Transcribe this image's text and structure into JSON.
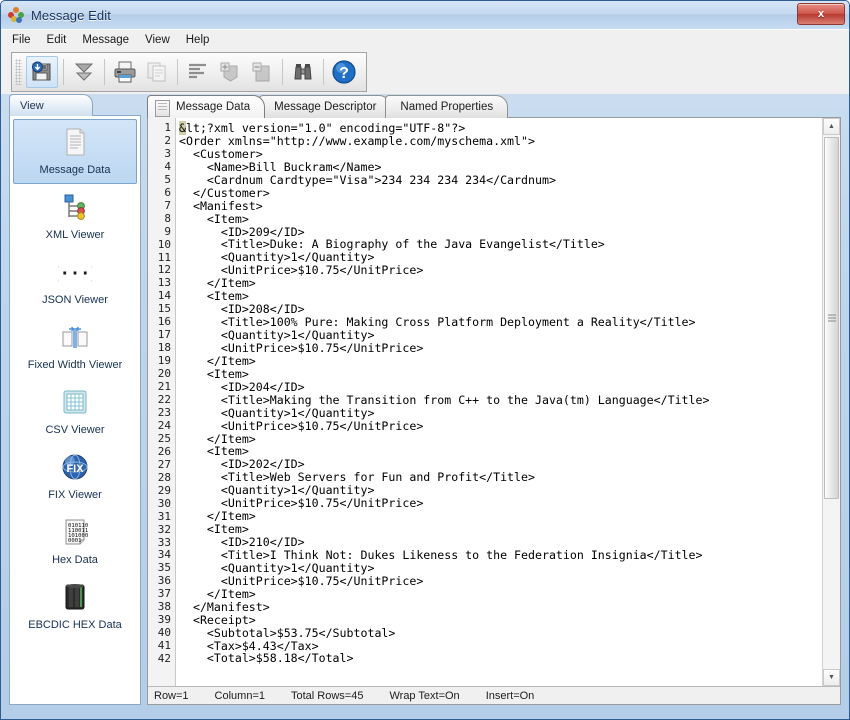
{
  "window": {
    "title": "Message Edit",
    "app_icon": "pinwheel-icon",
    "close_label": "x"
  },
  "menubar": {
    "items": [
      {
        "label": "File"
      },
      {
        "label": "Edit"
      },
      {
        "label": "Message"
      },
      {
        "label": "View"
      },
      {
        "label": "Help"
      }
    ]
  },
  "toolbar": {
    "buttons": [
      {
        "name": "save-button",
        "icon": "save-icon",
        "enabled": true
      },
      {
        "name": "collapse-all-button",
        "icon": "double-down-arrow-icon",
        "enabled": true
      },
      {
        "name": "print-button",
        "icon": "printer-icon",
        "enabled": true
      },
      {
        "name": "copy-button",
        "icon": "copy-icon",
        "enabled": false
      },
      {
        "name": "format-button",
        "icon": "align-left-icon",
        "enabled": true
      },
      {
        "name": "insert-row-button",
        "icon": "add-row-icon",
        "enabled": false
      },
      {
        "name": "delete-row-button",
        "icon": "remove-row-icon",
        "enabled": false
      },
      {
        "name": "find-button",
        "icon": "binoculars-icon",
        "enabled": true
      },
      {
        "name": "help-button",
        "icon": "question-mark-icon",
        "enabled": true
      }
    ]
  },
  "view_panel": {
    "tab_label": "View",
    "items": [
      {
        "label": "Message Data",
        "icon": "document-icon",
        "selected": true
      },
      {
        "label": "XML Viewer",
        "icon": "xml-tree-icon",
        "selected": false
      },
      {
        "label": "JSON Viewer",
        "icon": "json-braces-icon",
        "selected": false
      },
      {
        "label": "Fixed Width Viewer",
        "icon": "fixed-width-icon",
        "selected": false
      },
      {
        "label": "CSV Viewer",
        "icon": "grid-table-icon",
        "selected": false
      },
      {
        "label": "FIX Viewer",
        "icon": "fix-globe-icon",
        "selected": false
      },
      {
        "label": "Hex Data",
        "icon": "binary-page-icon",
        "selected": false
      },
      {
        "label": "EBCDIC HEX Data",
        "icon": "tape-drive-icon",
        "selected": false
      }
    ]
  },
  "tabs": [
    {
      "label": "Message Data",
      "active": true
    },
    {
      "label": "Message Descriptor",
      "active": false
    },
    {
      "label": "Named Properties",
      "active": false
    }
  ],
  "editor": {
    "first_line_number": 1,
    "lines": [
      "<?xml version=\"1.0\" encoding=\"UTF-8\"?>",
      "<Order xmlns=\"http://www.example.com/myschema.xml\">",
      "  <Customer>",
      "    <Name>Bill Buckram</Name>",
      "    <Cardnum Cardtype=\"Visa\">234 234 234 234</Cardnum>",
      "  </Customer>",
      "  <Manifest>",
      "    <Item>",
      "      <ID>209</ID>",
      "      <Title>Duke: A Biography of the Java Evangelist</Title>",
      "      <Quantity>1</Quantity>",
      "      <UnitPrice>$10.75</UnitPrice>",
      "    </Item>",
      "    <Item>",
      "      <ID>208</ID>",
      "      <Title>100% Pure: Making Cross Platform Deployment a Reality</Title>",
      "      <Quantity>1</Quantity>",
      "      <UnitPrice>$10.75</UnitPrice>",
      "    </Item>",
      "    <Item>",
      "      <ID>204</ID>",
      "      <Title>Making the Transition from C++ to the Java(tm) Language</Title>",
      "      <Quantity>1</Quantity>",
      "      <UnitPrice>$10.75</UnitPrice>",
      "    </Item>",
      "    <Item>",
      "      <ID>202</ID>",
      "      <Title>Web Servers for Fun and Profit</Title>",
      "      <Quantity>1</Quantity>",
      "      <UnitPrice>$10.75</UnitPrice>",
      "    </Item>",
      "    <Item>",
      "      <ID>210</ID>",
      "      <Title>I Think Not: Dukes Likeness to the Federation Insignia</Title>",
      "      <Quantity>1</Quantity>",
      "      <UnitPrice>$10.75</UnitPrice>",
      "    </Item>",
      "  </Manifest>",
      "  <Receipt>",
      "    <Subtotal>$53.75</Subtotal>",
      "    <Tax>$4.43</Tax>",
      "    <Total>$58.18</Total>"
    ]
  },
  "statusbar": {
    "cells": [
      "Row=1",
      "Column=1",
      "Total Rows=45",
      "Wrap Text=On",
      "Insert=On"
    ]
  }
}
